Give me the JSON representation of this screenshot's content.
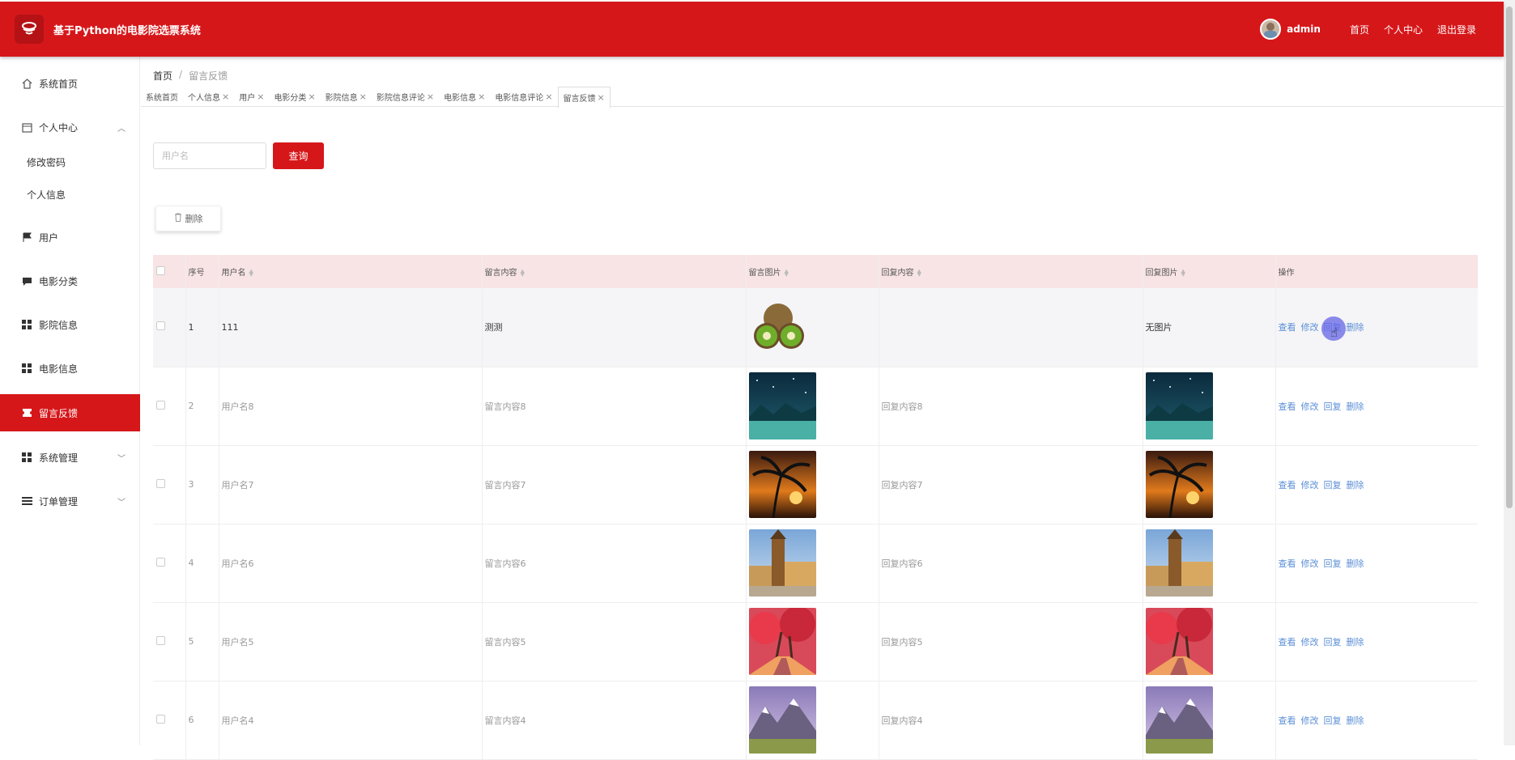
{
  "header": {
    "title": "基于Python的电影院选票系统",
    "username": "admin",
    "links": [
      "首页",
      "个人中心",
      "退出登录"
    ]
  },
  "sidebar": {
    "items": [
      {
        "label": "系统首页",
        "icon": "home-icon"
      },
      {
        "label": "个人中心",
        "icon": "calendar-icon",
        "expanded": true
      },
      {
        "label": "用户",
        "icon": "flag-icon"
      },
      {
        "label": "电影分类",
        "icon": "comment-icon"
      },
      {
        "label": "影院信息",
        "icon": "grid-icon"
      },
      {
        "label": "电影信息",
        "icon": "grid-icon"
      },
      {
        "label": "留言反馈",
        "icon": "ticket-icon",
        "active": true
      },
      {
        "label": "系统管理",
        "icon": "grid-icon"
      },
      {
        "label": "订单管理",
        "icon": "list-icon"
      }
    ],
    "sub_items": [
      "修改密码",
      "个人信息"
    ]
  },
  "breadcrumb": {
    "home": "首页",
    "current": "留言反馈"
  },
  "tabs": [
    {
      "label": "系统首页",
      "closable": false
    },
    {
      "label": "个人信息",
      "closable": true
    },
    {
      "label": "用户",
      "closable": true
    },
    {
      "label": "电影分类",
      "closable": true
    },
    {
      "label": "影院信息",
      "closable": true
    },
    {
      "label": "影院信息评论",
      "closable": true
    },
    {
      "label": "电影信息",
      "closable": true
    },
    {
      "label": "电影信息评论",
      "closable": true
    },
    {
      "label": "留言反馈",
      "closable": true,
      "active": true
    }
  ],
  "search": {
    "placeholder": "用户名",
    "value": "",
    "button": "查询"
  },
  "toolbar": {
    "delete_label": "删除"
  },
  "table": {
    "columns": [
      "序号",
      "用户名",
      "留言内容",
      "留言图片",
      "回复内容",
      "回复图片",
      "操作"
    ],
    "rows": [
      {
        "index": "1",
        "username": "111",
        "content": "测测",
        "image": "kiwi",
        "reply": "",
        "reply_image": "无图片",
        "ops": [
          "查看",
          "修改",
          "回复",
          "删除"
        ]
      },
      {
        "index": "2",
        "username": "用户名8",
        "content": "留言内容8",
        "image": "starry-lake",
        "reply": "回复内容8",
        "reply_image": "starry-lake",
        "ops": [
          "查看",
          "修改",
          "回复",
          "删除"
        ]
      },
      {
        "index": "3",
        "username": "用户名7",
        "content": "留言内容7",
        "image": "palm-sunset",
        "reply": "回复内容7",
        "reply_image": "palm-sunset",
        "ops": [
          "查看",
          "修改",
          "回复",
          "删除"
        ]
      },
      {
        "index": "4",
        "username": "用户名6",
        "content": "留言内容6",
        "image": "old-town",
        "reply": "回复内容6",
        "reply_image": "old-town",
        "ops": [
          "查看",
          "修改",
          "回复",
          "删除"
        ]
      },
      {
        "index": "5",
        "username": "用户名5",
        "content": "留言内容5",
        "image": "red-forest",
        "reply": "回复内容5",
        "reply_image": "red-forest",
        "ops": [
          "查看",
          "修改",
          "回复",
          "删除"
        ]
      },
      {
        "index": "6",
        "username": "用户名4",
        "content": "留言内容4",
        "image": "mountains",
        "reply": "回复内容4",
        "reply_image": "mountains",
        "ops": [
          "查看",
          "修改",
          "回复",
          "删除"
        ]
      }
    ]
  },
  "colors": {
    "brand": "#d6171a",
    "header_row": "#f8e4e5",
    "link": "#5b8fd6"
  }
}
